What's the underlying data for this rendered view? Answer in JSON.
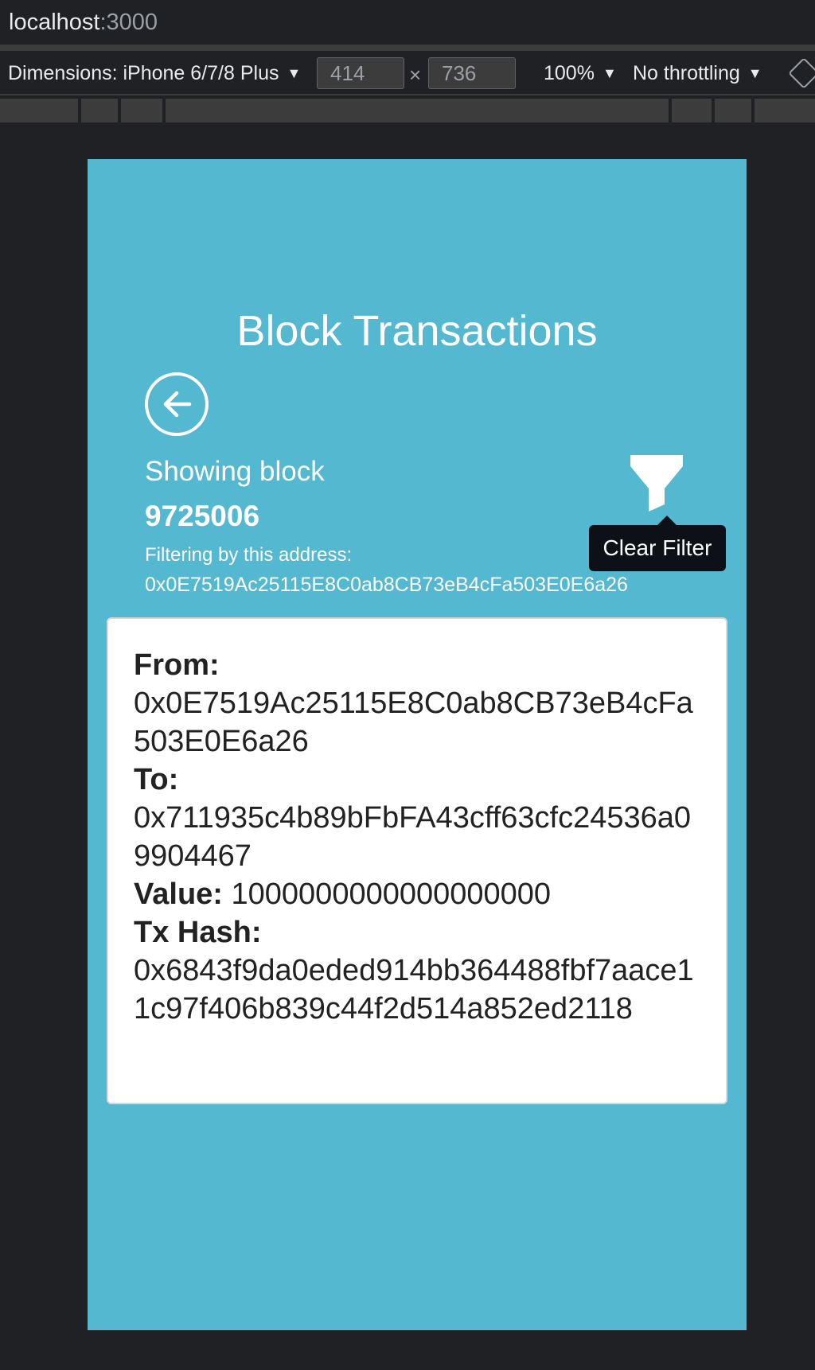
{
  "browser": {
    "host": "localhost",
    "port": ":3000"
  },
  "device_toolbar": {
    "dimensions_label": "Dimensions: iPhone 6/7/8 Plus",
    "width": "414",
    "height": "736",
    "times": "×",
    "zoom": "100%",
    "throttling": "No throttling",
    "caret": "▼"
  },
  "app": {
    "title": "Block Transactions",
    "showing_label": "Showing block",
    "block_number": "9725006",
    "filter_label": "Filtering by this address:",
    "filter_address": "0x0E7519Ac25115E8C0ab8CB73eB4cFa503E0E6a26",
    "tooltip": "Clear Filter",
    "colors": {
      "background": "#54b8d0",
      "card": "#ffffff",
      "tooltip": "#0d1117"
    }
  },
  "transaction": {
    "from_label": "From:",
    "from_value": "0x0E7519Ac25115E8C0ab8CB73eB4cFa503E0E6a26",
    "to_label": "To:",
    "to_value": "0x711935c4b89bFbFA43cff63cfc24536a09904467",
    "value_label": "Value:",
    "value_value": "1000000000000000000",
    "hash_label": "Tx Hash:",
    "hash_value": "0x6843f9da0eded914bb364488fbf7aace11c97f406b839c44f2d514a852ed2118"
  },
  "icons": {
    "back": "arrow-left-circle-icon",
    "filter": "filter-funnel-icon",
    "rotate": "rotate-device-icon"
  }
}
